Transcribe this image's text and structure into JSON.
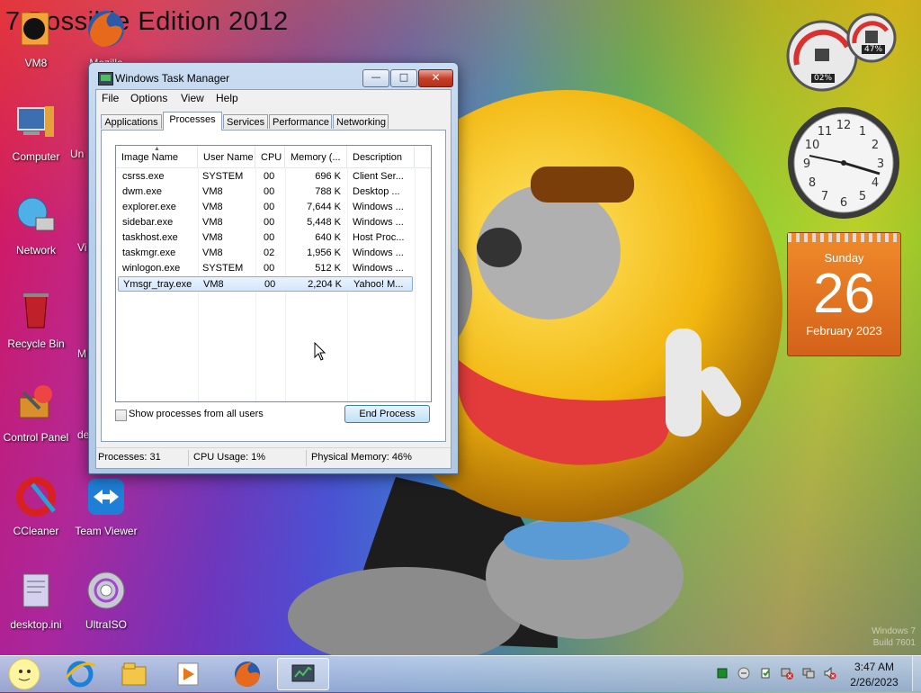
{
  "desktop": {
    "title_text": "7 Possible Edition 2012",
    "icons": [
      {
        "label": "VM8",
        "icon": "vmware-icon"
      },
      {
        "label": "Mozilla",
        "icon": "firefox-icon"
      },
      {
        "label": "Computer",
        "icon": "computer-icon"
      },
      {
        "label": "Network",
        "icon": "network-icon"
      },
      {
        "label": "Recycle Bin",
        "icon": "recycle-bin-icon"
      },
      {
        "label": "Control Panel",
        "icon": "control-panel-icon"
      },
      {
        "label": "CCleaner",
        "icon": "ccleaner-icon"
      },
      {
        "label": "Team Viewer",
        "icon": "teamviewer-icon"
      },
      {
        "label": "desktop.ini",
        "icon": "ini-file-icon"
      },
      {
        "label": "UltraISO",
        "icon": "ultraiso-icon"
      }
    ],
    "partial_labels": [
      "Un",
      "Vi",
      "M",
      "de"
    ],
    "watermark": {
      "line1": "Windows 7",
      "line2": "Build 7601"
    }
  },
  "gadgets": {
    "cpu_meter": {
      "cpu": "02%",
      "memory": "47%"
    },
    "clock_numbers": [
      "12",
      "1",
      "2",
      "3",
      "4",
      "5",
      "6",
      "7",
      "8",
      "9",
      "10",
      "11"
    ],
    "calendar": {
      "weekday": "Sunday",
      "day": "26",
      "month_year": "February 2023"
    }
  },
  "task_manager": {
    "title": "Windows Task Manager",
    "window_buttons": {
      "minimize": "—",
      "maximize": "□",
      "close": "✕"
    },
    "menu": [
      "File",
      "Options",
      "View",
      "Help"
    ],
    "tabs": [
      "Applications",
      "Processes",
      "Services",
      "Performance",
      "Networking"
    ],
    "active_tab": "Processes",
    "columns": [
      "Image Name",
      "User Name",
      "CPU",
      "Memory (...",
      "Description"
    ],
    "processes": [
      {
        "name": "csrss.exe",
        "user": "SYSTEM",
        "cpu": "00",
        "memory": "696 K",
        "desc": "Client Ser..."
      },
      {
        "name": "dwm.exe",
        "user": "VM8",
        "cpu": "00",
        "memory": "788 K",
        "desc": "Desktop ..."
      },
      {
        "name": "explorer.exe",
        "user": "VM8",
        "cpu": "00",
        "memory": "7,644 K",
        "desc": "Windows ..."
      },
      {
        "name": "sidebar.exe",
        "user": "VM8",
        "cpu": "00",
        "memory": "5,448 K",
        "desc": "Windows ..."
      },
      {
        "name": "taskhost.exe",
        "user": "VM8",
        "cpu": "00",
        "memory": "640 K",
        "desc": "Host Proc..."
      },
      {
        "name": "taskmgr.exe",
        "user": "VM8",
        "cpu": "02",
        "memory": "1,956 K",
        "desc": "Windows ..."
      },
      {
        "name": "winlogon.exe",
        "user": "SYSTEM",
        "cpu": "00",
        "memory": "512 K",
        "desc": "Windows ..."
      },
      {
        "name": "Ymsgr_tray.exe",
        "user": "VM8",
        "cpu": "00",
        "memory": "2,204 K",
        "desc": "Yahoo! M..."
      }
    ],
    "selected_process": "Ymsgr_tray.exe",
    "show_all_users_label": "Show processes from all users",
    "show_all_users_checked": false,
    "end_process_label": "End Process",
    "status": {
      "processes": "Processes: 31",
      "cpu": "CPU Usage: 1%",
      "memory": "Physical Memory: 46%"
    }
  },
  "taskbar": {
    "buttons": [
      "start-orb-icon",
      "internet-explorer-icon",
      "windows-explorer-icon",
      "media-player-icon",
      "firefox-icon",
      "task-manager-icon"
    ],
    "tray_icons": [
      "vm-status-icon",
      "network-activity-icon",
      "action-center-icon",
      "network-disconnected-icon",
      "network-icon",
      "volume-muted-icon"
    ],
    "time": "3:47 AM",
    "date": "2/26/2023"
  }
}
